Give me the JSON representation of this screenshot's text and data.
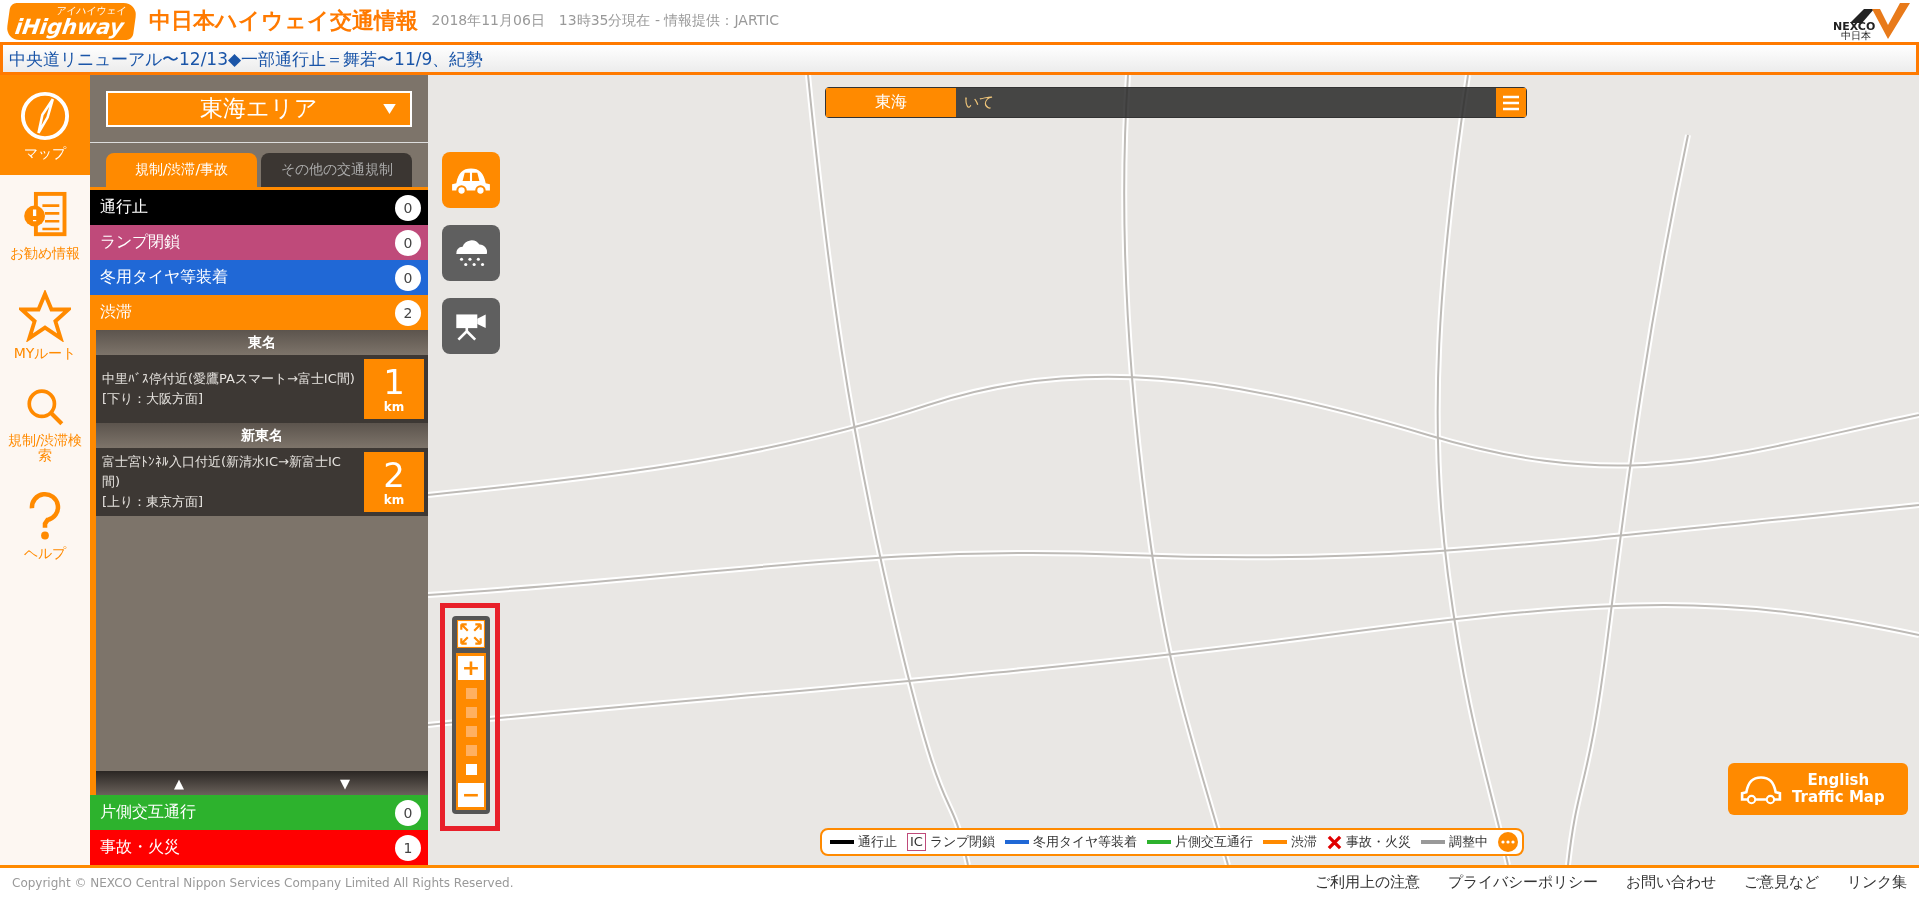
{
  "header": {
    "logo": {
      "ruby": "アイハイウェイ",
      "text": "iHighway"
    },
    "title": "中日本ハイウェイ交通情報",
    "date": "2018年11月06日",
    "updated": "13時35分現在 - 情報提供：JARTIC",
    "brand": {
      "name": "NEXCO",
      "sub": "中日本"
    }
  },
  "ticker": "中央道リニューアル〜12/13◆一部通行止＝舞若〜11/9、紀勢",
  "nav": [
    {
      "label": "マップ",
      "selected": true
    },
    {
      "label": "お勧め情報",
      "selected": false
    },
    {
      "label": "MYルート",
      "selected": false
    },
    {
      "label": "規制/渋滞検索",
      "selected": false
    },
    {
      "label": "ヘルプ",
      "selected": false
    }
  ],
  "sidebar": {
    "area": "東海エリア",
    "tabs": [
      {
        "label": "規制/渋滞/事故",
        "selected": true
      },
      {
        "label": "その他の交通規制",
        "selected": false
      }
    ],
    "upper_categories": [
      {
        "label": "通行止",
        "count": "0",
        "color": "#000000"
      },
      {
        "label": "ランプ閉鎖",
        "count": "0",
        "color": "#bf4a7a"
      },
      {
        "label": "冬用タイヤ等装着",
        "count": "0",
        "color": "#2068d6"
      },
      {
        "label": "渋滞",
        "count": "2",
        "color": "#ff8a00"
      }
    ],
    "congestion_groups": [
      {
        "road": "東名",
        "items": [
          {
            "place": "中里ﾊﾞｽ停付近(愛鷹PAスマート→富士IC間)",
            "direction": "[下り：大阪方面]",
            "length": "1",
            "unit": "km"
          }
        ]
      },
      {
        "road": "新東名",
        "items": [
          {
            "place": "富士宮ﾄﾝﾈﾙ入口付近(新清水IC→新富士IC間)",
            "direction": "[上り：東京方面]",
            "length": "2",
            "unit": "km"
          }
        ]
      }
    ],
    "scroll_up": "▲",
    "scroll_down": "▼",
    "lower_categories": [
      {
        "label": "片側交互通行",
        "count": "0",
        "color": "#2db22d"
      },
      {
        "label": "事故・火災",
        "count": "1",
        "color": "#ff0000"
      }
    ]
  },
  "map": {
    "area_label": "東海",
    "search_text": "いて",
    "layers": [
      {
        "selected": true
      },
      {
        "selected": false
      },
      {
        "selected": false
      }
    ],
    "zoom": {
      "plus": "+",
      "minus": "−",
      "steps": [
        {
          "selected": false
        },
        {
          "selected": false
        },
        {
          "selected": false
        },
        {
          "selected": false
        },
        {
          "selected": true
        }
      ]
    },
    "legend": [
      {
        "kind": "line",
        "label": "通行止",
        "color": "#000000"
      },
      {
        "kind": "ic",
        "mark": "IC",
        "label": "ランプ閉鎖",
        "color": "#bf4a7a"
      },
      {
        "kind": "line",
        "label": "冬用タイヤ等装着",
        "color": "#2068d6"
      },
      {
        "kind": "line",
        "label": "片側交互通行",
        "color": "#2db22d"
      },
      {
        "kind": "line",
        "label": "渋滞",
        "color": "#ff8a00"
      },
      {
        "kind": "cross",
        "label": "事故・火災",
        "color": "#e00000"
      },
      {
        "kind": "line",
        "label": "調整中",
        "color": "#999999"
      }
    ],
    "english_button": [
      "English",
      "Traffic Map"
    ]
  },
  "footer": {
    "copyright": "Copyright © NEXCO Central Nippon Services Company Limited All Rights Reserved.",
    "links": [
      "ご利用上の注意",
      "プライバシーポリシー",
      "お問い合わせ",
      "ご意見など",
      "リンク集"
    ]
  }
}
